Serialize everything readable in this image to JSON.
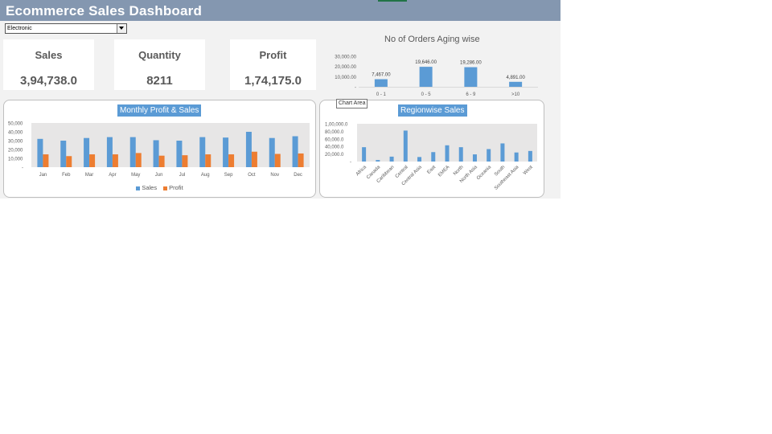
{
  "dashboard": {
    "title": "Ecommerce Sales Dashboard",
    "filter": {
      "selected": "Electronic"
    },
    "kpis": {
      "sales": {
        "label": "Sales",
        "value": "3,94,738.0"
      },
      "quantity": {
        "label": "Quantity",
        "value": "8211"
      },
      "profit": {
        "label": "Profit",
        "value": "1,74,175.0"
      }
    },
    "tooltip": "Chart Area"
  },
  "colors": {
    "header": "#8497b0",
    "sales": "#5b9bd5",
    "profit": "#ed7d31",
    "background": "#f2f2f2"
  },
  "chart_data": [
    {
      "id": "aging",
      "type": "bar",
      "title": "No of Orders Aging wise",
      "categories": [
        "0 - 1",
        "0 - 5",
        "6 - 9",
        ">10"
      ],
      "values": [
        7467.0,
        19646.0,
        19286.0,
        4891.0
      ],
      "data_labels": [
        "7,467.00",
        "19,646.00",
        "19,286.00",
        "4,891.00"
      ],
      "y_ticks": [
        "30,000.00",
        "20,000.00",
        "10,000.00",
        "-"
      ],
      "ylim": [
        0,
        30000
      ],
      "grid": false
    },
    {
      "id": "monthly",
      "type": "bar",
      "title": "Monthly Profit & Sales",
      "categories": [
        "Jan",
        "Feb",
        "Mar",
        "Apr",
        "May",
        "Jun",
        "Jul",
        "Aug",
        "Sep",
        "Oct",
        "Nov",
        "Dec"
      ],
      "series": [
        {
          "name": "Sales",
          "values": [
            32000,
            30000,
            33000,
            34000,
            34000,
            30500,
            30000,
            34000,
            33500,
            40000,
            33000,
            35000
          ]
        },
        {
          "name": "Profit",
          "values": [
            14500,
            12500,
            14500,
            14500,
            16000,
            13000,
            13500,
            14500,
            14500,
            17500,
            15000,
            15500
          ]
        }
      ],
      "y_ticks": [
        "50,000",
        "40,000",
        "30,000",
        "20,000",
        "10,000",
        "-"
      ],
      "ylim": [
        0,
        50000
      ],
      "legend": "bottom"
    },
    {
      "id": "regionwise",
      "type": "bar",
      "title": "Regionwise Sales",
      "categories": [
        "Africa",
        "Canada",
        "Caribbean",
        "Central",
        "Central Asia",
        "East",
        "EMEA",
        "North",
        "North Asia",
        "Oceania",
        "South",
        "Southeast Asia",
        "West"
      ],
      "values": [
        38000,
        4000,
        13000,
        82000,
        12000,
        25000,
        43000,
        38000,
        19000,
        33000,
        48000,
        24000,
        28000
      ],
      "y_ticks": [
        "1,00,000.0",
        "80,000.0",
        "60,000.0",
        "40,000.0",
        "20,000.0",
        "-"
      ],
      "ylim": [
        0,
        100000
      ]
    }
  ]
}
